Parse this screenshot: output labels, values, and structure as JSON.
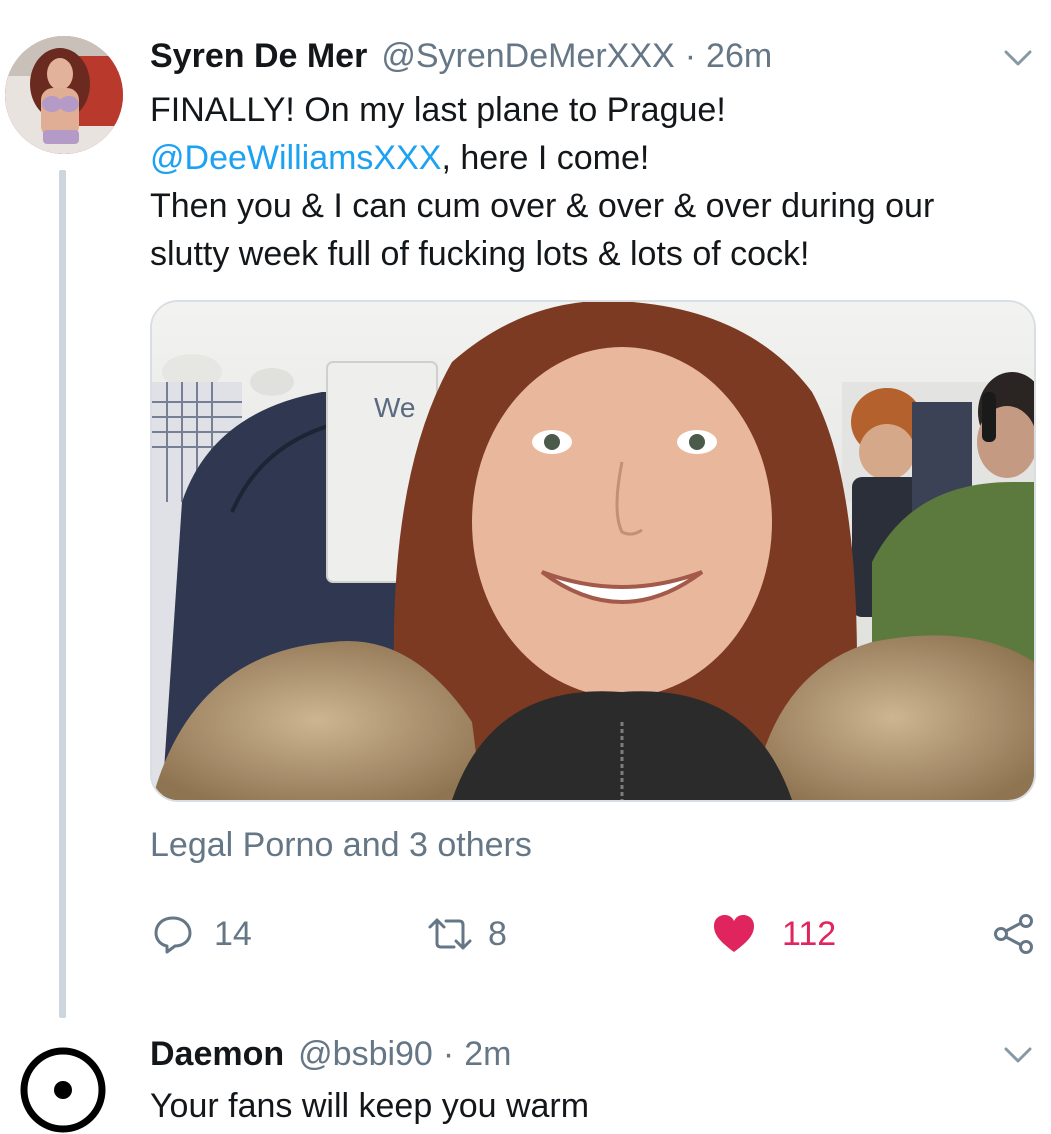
{
  "tweet": {
    "author_name": "Syren De Mer",
    "handle": "@SyrenDeMerXXX",
    "separator": "·",
    "time": "26m",
    "text_line1": "FINALLY! On my last plane to Prague!",
    "mention": "@DeeWilliamsXXX",
    "text_line2_rest": ", here I come!",
    "text_line3": "Then you & I can cum over & over & over during our",
    "text_line4": "slutty week full of fucking lots & lots of cock!",
    "media_overlay_text": "We",
    "likers": "Legal Porno and 3 others",
    "reply_count": "14",
    "retweet_count": "8",
    "like_count": "112",
    "liked": true
  },
  "reply": {
    "author_name": "Daemon",
    "handle": "@bsbi90",
    "separator": "·",
    "time": "2m",
    "text": "Your fans will keep you warm"
  },
  "icons": {
    "reply": "reply-bubble-icon",
    "retweet": "retweet-icon",
    "like": "heart-icon",
    "share": "share-icon",
    "caret": "chevron-down-icon"
  },
  "colors": {
    "text": "#14171a",
    "secondary": "#657786",
    "link": "#1da1f2",
    "like": "#e0245e",
    "thread_line": "#cdd6dd"
  }
}
